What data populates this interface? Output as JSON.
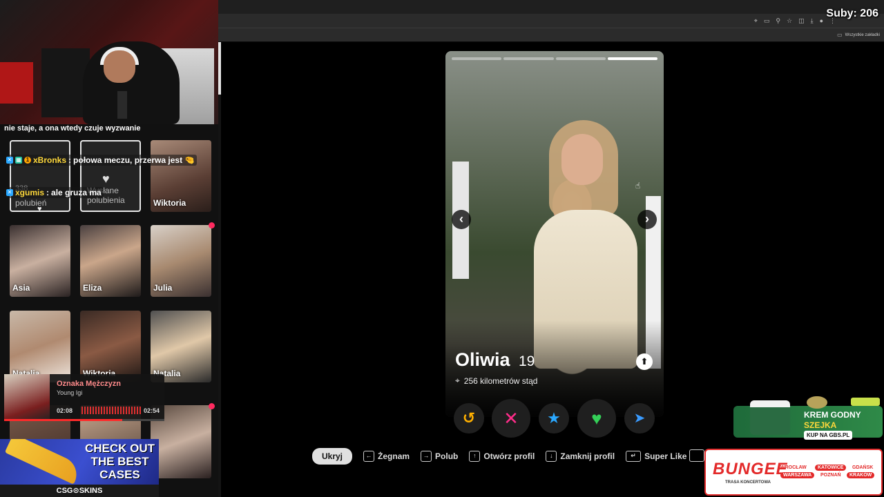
{
  "overlay": {
    "subs": "Suby: 206"
  },
  "browser": {
    "bookmarks_label": "Wszystkie zakładki",
    "toolbar_icons": [
      "location-icon",
      "cast-icon",
      "zoom-icon",
      "star-icon",
      "extension-icon",
      "download-icon",
      "profile-icon",
      "menu-icon"
    ]
  },
  "chat": {
    "top_line": "nie staje, a ona wtedy czuje wyzwanie",
    "messages": [
      {
        "user": "xBronks",
        "text": "połowa meczu, przerwa jest",
        "badge_color": "#ffa500"
      },
      {
        "user": "xgumis",
        "text": "ale gruza ma",
        "badge_color": "#4ab8ff"
      }
    ]
  },
  "sidebar": {
    "likes_card": {
      "count": "338",
      "label": "polubień"
    },
    "sent_card": {
      "label": "Wysłane polubienia"
    },
    "matches": [
      {
        "name": "Wiktoria"
      },
      {
        "name": "Asia"
      },
      {
        "name": "Eliza"
      },
      {
        "name": "Julia"
      },
      {
        "name": "Natalia"
      },
      {
        "name": "Wiktoria"
      },
      {
        "name": "Natalia"
      }
    ]
  },
  "player": {
    "title": "Oznaka Mężczyzn",
    "artist": "Young Igi",
    "current": "02:08",
    "total": "02:54",
    "progress": 0.736
  },
  "ad_csgo": {
    "headline1": "CHECK OUT",
    "headline2": "THE BEST",
    "headline3": "CASES",
    "brand": "CSG⊙SKINS"
  },
  "profile": {
    "name": "Oliwia",
    "age": "19",
    "distance": "256 kilometrów stąd",
    "photo_count": 4,
    "active_photo": 4
  },
  "actions": [
    {
      "name": "rewind",
      "glyph": "↺",
      "color": "#ffb000"
    },
    {
      "name": "nope",
      "glyph": "✕",
      "color": "#ff2d8a"
    },
    {
      "name": "super-like",
      "glyph": "★",
      "color": "#2aa8ff"
    },
    {
      "name": "like",
      "glyph": "♥",
      "color": "#34d058"
    },
    {
      "name": "boost",
      "glyph": "➤",
      "color": "#3a9bff"
    }
  ],
  "shortcuts": {
    "hide": "Ukryj",
    "items": [
      {
        "key": "←",
        "label": "Żegnam"
      },
      {
        "key": "→",
        "label": "Polub"
      },
      {
        "key": "↑",
        "label": "Otwórz profil"
      },
      {
        "key": "↓",
        "label": "Zamknij profil"
      },
      {
        "key": "↵",
        "label": "Super Like"
      }
    ]
  },
  "ad_krem": {
    "line1": "KREM GODNY",
    "line2": "SZEJKA",
    "cta": "KUP NA GBS.PL"
  },
  "ad_bungee": {
    "logo": "BUNGEE",
    "sub": "TRASA KONCERTOWA",
    "cities": [
      "WROCŁAW",
      "KATOWICE",
      "GDAŃSK",
      "WARSZAWA",
      "POZNAŃ",
      "KRAKÓW"
    ]
  }
}
